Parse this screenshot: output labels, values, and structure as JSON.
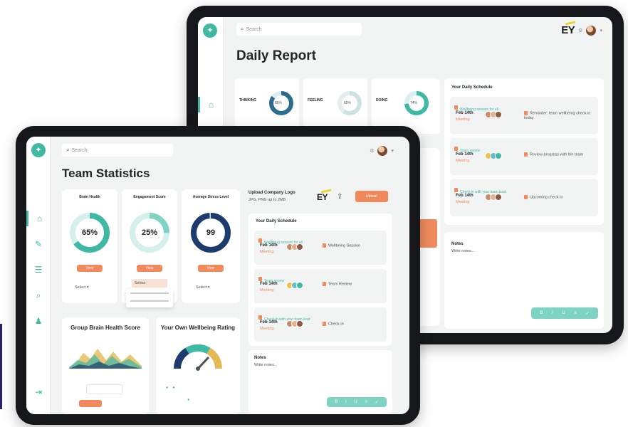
{
  "colors": {
    "accent": "#3fb9a4",
    "orange": "#f08a5d",
    "navy": "#1e3b6e",
    "ey_yellow": "#f2d22e"
  },
  "back_tablet": {
    "search_placeholder": "Search",
    "brand": "EY",
    "title": "Daily Report",
    "metrics": [
      {
        "label": "THINKING",
        "value": "85%",
        "percent": 85
      },
      {
        "label": "FEELING",
        "value": "60%",
        "percent": 60
      },
      {
        "label": "DOING",
        "value": "74%",
        "percent": 74
      }
    ],
    "schedule_title": "Your Daily Schedule",
    "schedule": [
      {
        "time": "Feb 14th",
        "sub": "Meeting"
      },
      {
        "time": "Feb 14th",
        "sub": "Meeting"
      },
      {
        "time": "Feb 14th",
        "sub": "Meeting"
      }
    ],
    "notes_title": "Notes",
    "notes_placeholder": "Write notes..."
  },
  "front_tablet": {
    "search_placeholder": "Search",
    "title": "Team Statistics",
    "stats": [
      {
        "label": "Brain Health",
        "value": "65%",
        "percent": 65,
        "button": "View",
        "select": "Select"
      },
      {
        "label": "Engagement Score",
        "value": "25%",
        "percent": 25,
        "button": "View",
        "select": "Select"
      },
      {
        "label": "Average Stress Level",
        "value": "99",
        "percent": 99,
        "button": "View",
        "select": "Select"
      }
    ],
    "upload": {
      "title": "Upload Company Logo",
      "subtitle": "JPG, PNG up to 2MB",
      "brand": "EY",
      "button": "Upload"
    },
    "schedule_title": "Your Daily Schedule",
    "schedule": [
      {
        "time": "Feb 14th",
        "sub": "Meeting",
        "task": "Wellbeing Session"
      },
      {
        "time": "Feb 14th",
        "sub": "Meeting",
        "task": "Team Review"
      },
      {
        "time": "Feb 14th",
        "sub": "Meeting",
        "task": "Check-in"
      }
    ],
    "brain_title": "Group Brain Health Score",
    "wellbeing_title": "Your Own Wellbeing Rating",
    "notes_title": "Notes",
    "notes_placeholder": "Write notes..."
  }
}
